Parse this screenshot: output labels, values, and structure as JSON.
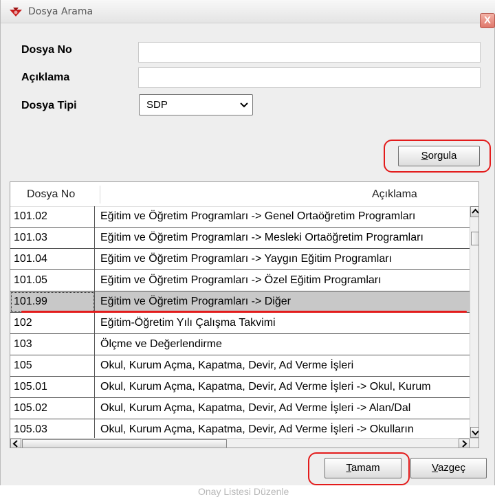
{
  "window": {
    "title": "Dosya Arama",
    "close_symbol": "X"
  },
  "form": {
    "dosya_no_label": "Dosya No",
    "dosya_no_value": "",
    "aciklama_label": "Açıklama",
    "aciklama_value": "",
    "dosya_tipi_label": "Dosya Tipi",
    "dosya_tipi_value": "SDP"
  },
  "buttons": {
    "sorgula": {
      "mnemonic": "S",
      "rest": "orgula"
    },
    "tamam": {
      "mnemonic": "T",
      "rest": "amam"
    },
    "vazgec": {
      "mnemonic": "V",
      "rest": "azgeç"
    }
  },
  "table": {
    "columns": [
      "Dosya No",
      "Açıklama"
    ],
    "selected_row": 4,
    "rows": [
      [
        "101.02",
        "Eğitim ve Öğretim Programları -> Genel Ortaöğretim Programları"
      ],
      [
        "101.03",
        "Eğitim ve Öğretim Programları -> Mesleki Ortaöğretim Programları"
      ],
      [
        "101.04",
        "Eğitim ve Öğretim Programları -> Yaygın Eğitim Programları"
      ],
      [
        "101.05",
        "Eğitim ve Öğretim Programları -> Özel Eğitim Programları"
      ],
      [
        "101.99",
        "Eğitim ve Öğretim Programları -> Diğer"
      ],
      [
        "102",
        "Eğitim-Öğretim Yılı Çalışma Takvimi"
      ],
      [
        "103",
        "Ölçme ve Değerlendirme"
      ],
      [
        "105",
        "Okul, Kurum Açma, Kapatma, Devir, Ad Verme İşleri"
      ],
      [
        "105.01",
        "Okul, Kurum Açma, Kapatma, Devir, Ad Verme İşleri  -> Okul, Kurum"
      ],
      [
        "105.02",
        "Okul, Kurum Açma, Kapatma, Devir, Ad Verme İşleri  -> Alan/Dal"
      ],
      [
        "105.03",
        "Okul, Kurum Açma, Kapatma, Devir, Ad Verme İşleri  -> Okulların"
      ]
    ]
  },
  "background_text": "Onay Listesi Düzenle",
  "colors": {
    "annotation_red": "#e31b1b",
    "selection_gray": "#c8c8c8"
  }
}
